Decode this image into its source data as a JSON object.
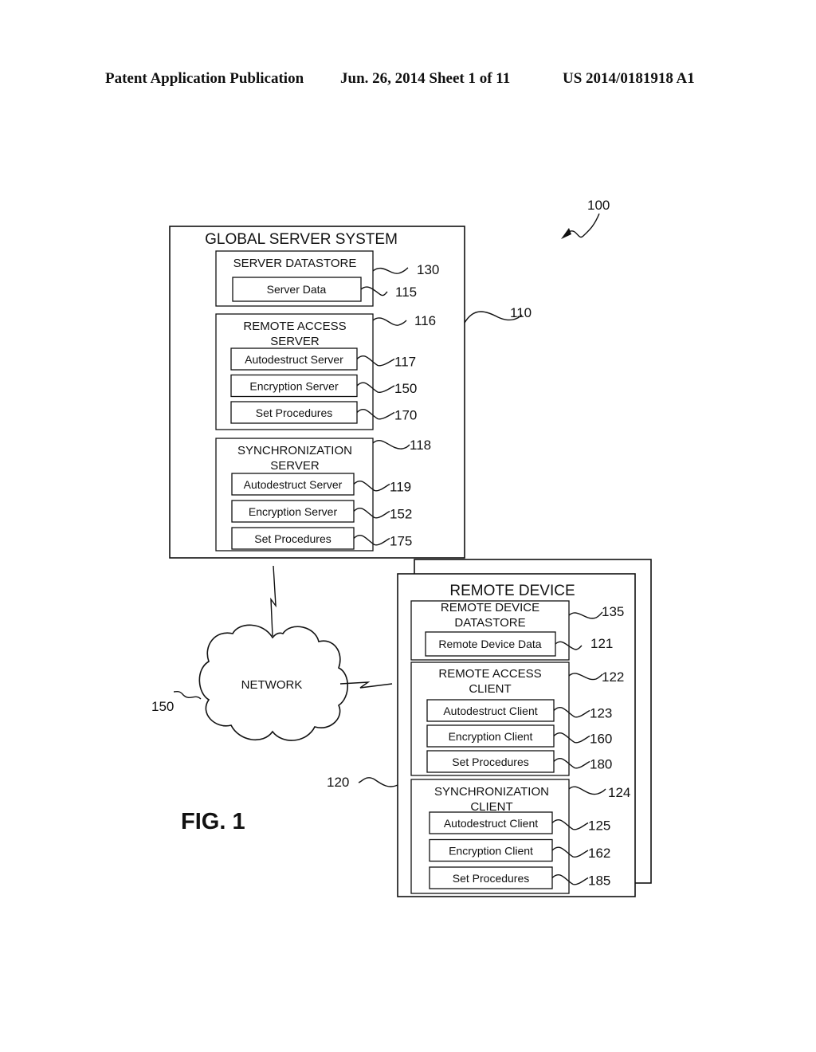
{
  "header": {
    "publication": "Patent Application Publication",
    "date_sheet": "Jun. 26, 2014  Sheet 1 of 11",
    "number": "US 2014/0181918 A1"
  },
  "figure": {
    "label": "FIG. 1",
    "system_ref": "100",
    "global_server": {
      "title": "GLOBAL SERVER SYSTEM",
      "ref": "110",
      "datastore": {
        "title": "SERVER DATASTORE",
        "ref": "130",
        "item": {
          "label": "Server Data",
          "ref": "115"
        }
      },
      "remote_access_server": {
        "title_line1": "REMOTE ACCESS",
        "title_line2": "SERVER",
        "ref": "116",
        "items": [
          {
            "label": "Autodestruct Server",
            "ref": "117"
          },
          {
            "label": "Encryption Server",
            "ref": "150"
          },
          {
            "label": "Set Procedures",
            "ref": "170"
          }
        ]
      },
      "sync_server": {
        "title_line1": "SYNCHRONIZATION",
        "title_line2": "SERVER",
        "ref": "118",
        "items": [
          {
            "label": "Autodestruct Server",
            "ref": "119"
          },
          {
            "label": "Encryption Server",
            "ref": "152"
          },
          {
            "label": "Set Procedures",
            "ref": "175"
          }
        ]
      }
    },
    "network": {
      "label": "NETWORK",
      "ref": "150"
    },
    "remote_device": {
      "title": "REMOTE DEVICE",
      "ref": "120",
      "datastore": {
        "title_line1": "REMOTE DEVICE",
        "title_line2": "DATASTORE",
        "ref": "135",
        "item": {
          "label": "Remote Device Data",
          "ref": "121"
        }
      },
      "remote_access_client": {
        "title_line1": "REMOTE ACCESS",
        "title_line2": "CLIENT",
        "ref": "122",
        "items": [
          {
            "label": "Autodestruct Client",
            "ref": "123"
          },
          {
            "label": "Encryption Client",
            "ref": "160"
          },
          {
            "label": "Set Procedures",
            "ref": "180"
          }
        ]
      },
      "sync_client": {
        "title_line1": "SYNCHRONIZATION",
        "title_line2": "CLIENT",
        "ref": "124",
        "items": [
          {
            "label": "Autodestruct Client",
            "ref": "125"
          },
          {
            "label": "Encryption Client",
            "ref": "162"
          },
          {
            "label": "Set Procedures",
            "ref": "185"
          }
        ]
      }
    }
  }
}
